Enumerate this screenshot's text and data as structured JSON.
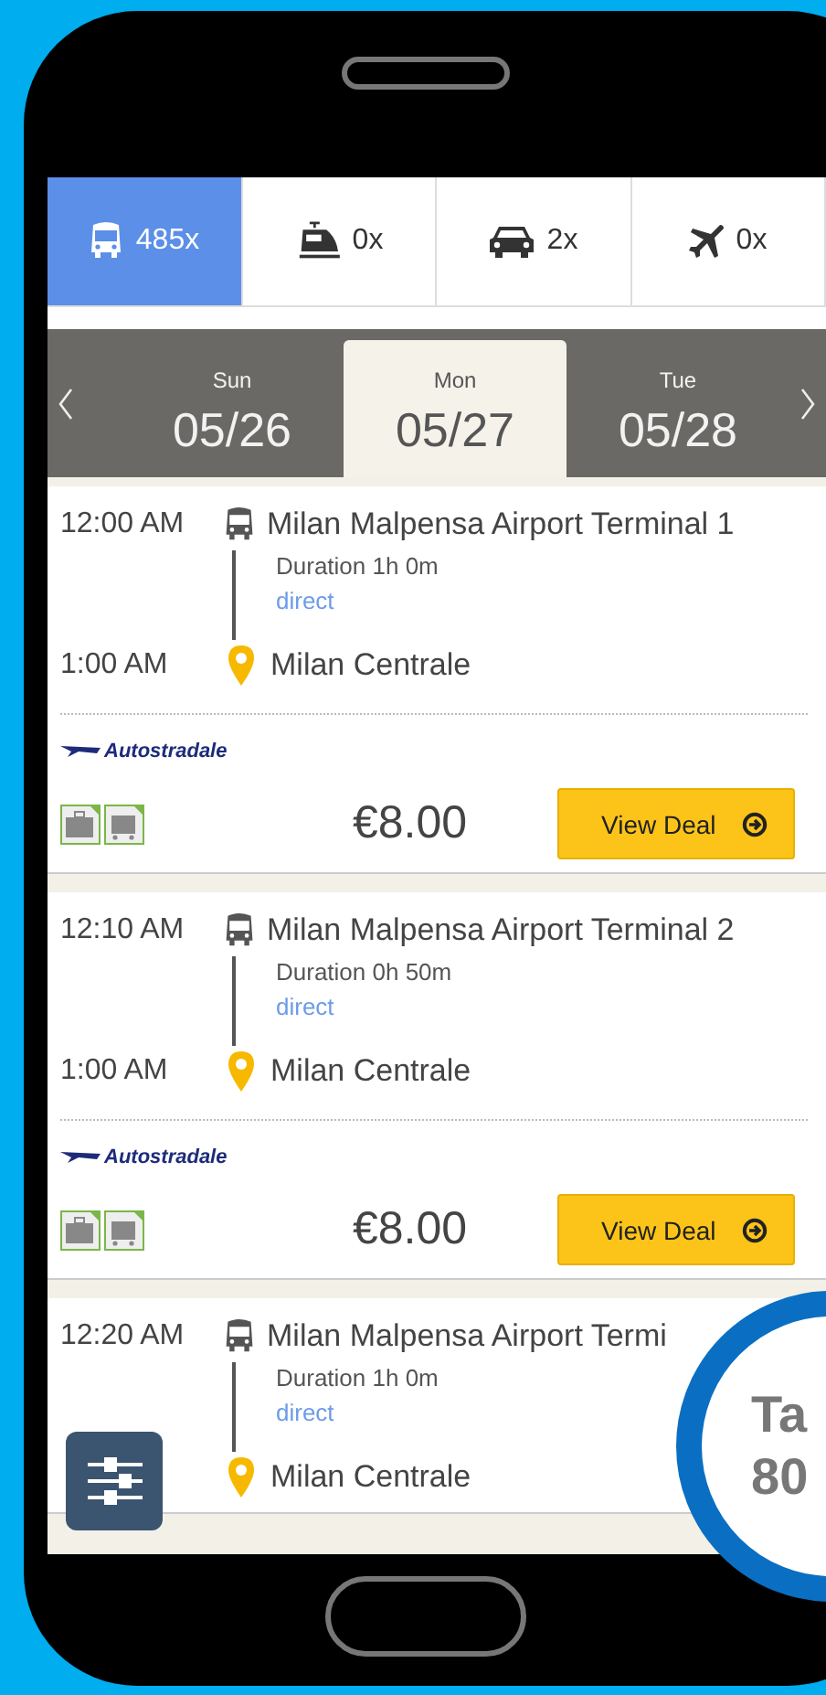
{
  "tabs": [
    {
      "kind": "bus",
      "label": "485x",
      "selected": true
    },
    {
      "kind": "train",
      "label": "0x",
      "selected": false
    },
    {
      "kind": "car",
      "label": "2x",
      "selected": false
    },
    {
      "kind": "plane",
      "label": "0x",
      "selected": false
    }
  ],
  "dates": [
    {
      "day": "Sun",
      "date": "05/26",
      "selected": false
    },
    {
      "day": "Mon",
      "date": "05/27",
      "selected": true
    },
    {
      "day": "Tue",
      "date": "05/28",
      "selected": false
    }
  ],
  "trips": [
    {
      "depart_time": "12:00 AM",
      "depart_station": "Milan Malpensa Airport Terminal 1",
      "duration": "Duration 1h 0m",
      "route": "direct",
      "arrive_time": "1:00 AM",
      "arrive_station": "Milan Centrale",
      "operator": "Autostradale",
      "price": "€8.00",
      "button": "View Deal"
    },
    {
      "depart_time": "12:10 AM",
      "depart_station": "Milan Malpensa Airport Terminal 2",
      "duration": "Duration 0h 50m",
      "route": "direct",
      "arrive_time": "1:00 AM",
      "arrive_station": "Milan Centrale",
      "operator": "Autostradale",
      "price": "€8.00",
      "button": "View Deal"
    },
    {
      "depart_time": "12:20 AM",
      "depart_station": "Milan Malpensa Airport Termi",
      "duration": "Duration 1h 0m",
      "route": "direct",
      "arrive_station": "Milan Centrale"
    }
  ],
  "badge": {
    "lines": [
      "Ta",
      "80"
    ]
  }
}
